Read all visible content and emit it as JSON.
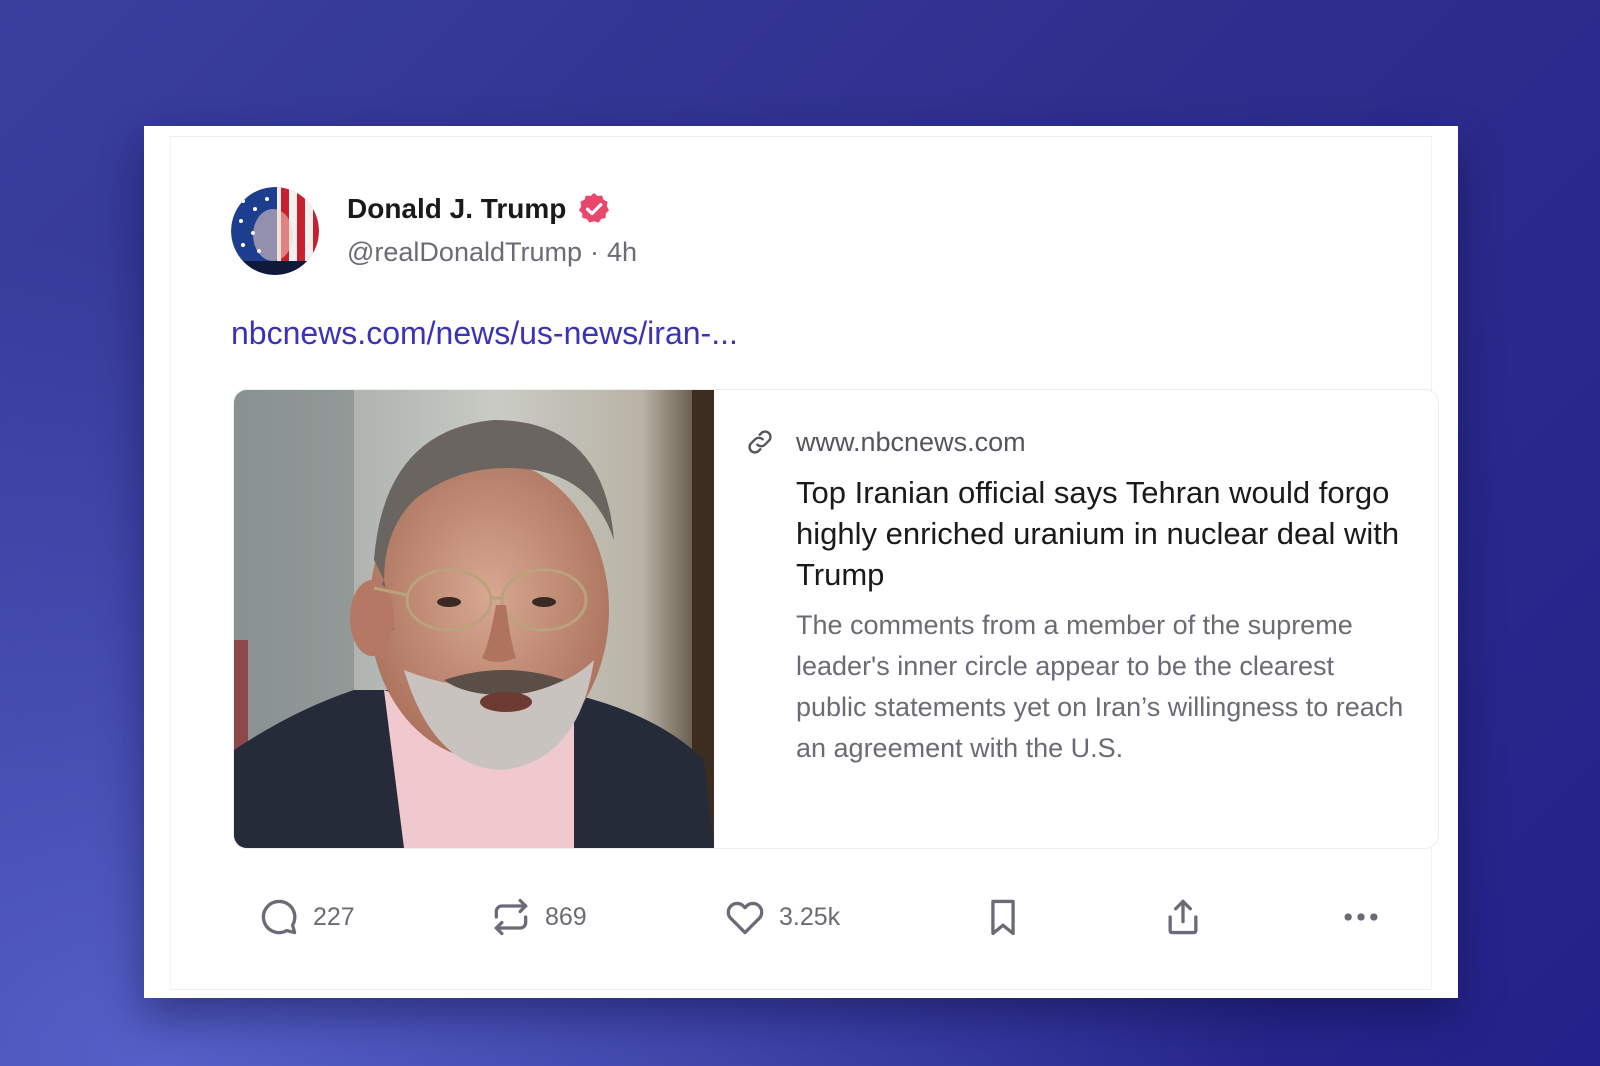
{
  "post": {
    "author": {
      "display_name": "Donald J. Trump",
      "handle": "@realDonaldTrump",
      "separator": "·",
      "time_ago": "4h",
      "verified_color": "#e9466b"
    },
    "link_text": "nbcnews.com/news/us-news/iran-...",
    "link_card": {
      "domain": "www.nbcnews.com",
      "title": "Top Iranian official says Tehran would forgo highly enriched uranium in nuclear deal with Trump",
      "description": "The comments from a member of the supreme leader's inner circle appear to be the clearest public statements yet on Iran’s willingness to reach an agreement with the U.S."
    },
    "actions": {
      "replies": "227",
      "reposts": "869",
      "likes": "3.25k"
    }
  },
  "colors": {
    "link": "#3b32b8",
    "muted_text": "#6b6b78",
    "primary_text": "#1a1a1a",
    "background_gradient": [
      "#3a3f9e",
      "#23228a"
    ]
  },
  "icons": {
    "reply": "speech-bubble-icon",
    "repost": "repost-arrows-icon",
    "like": "heart-icon",
    "bookmark": "bookmark-icon",
    "share": "share-upload-icon",
    "more": "more-dots-icon",
    "link": "chain-link-icon",
    "verified": "verified-badge-icon"
  }
}
